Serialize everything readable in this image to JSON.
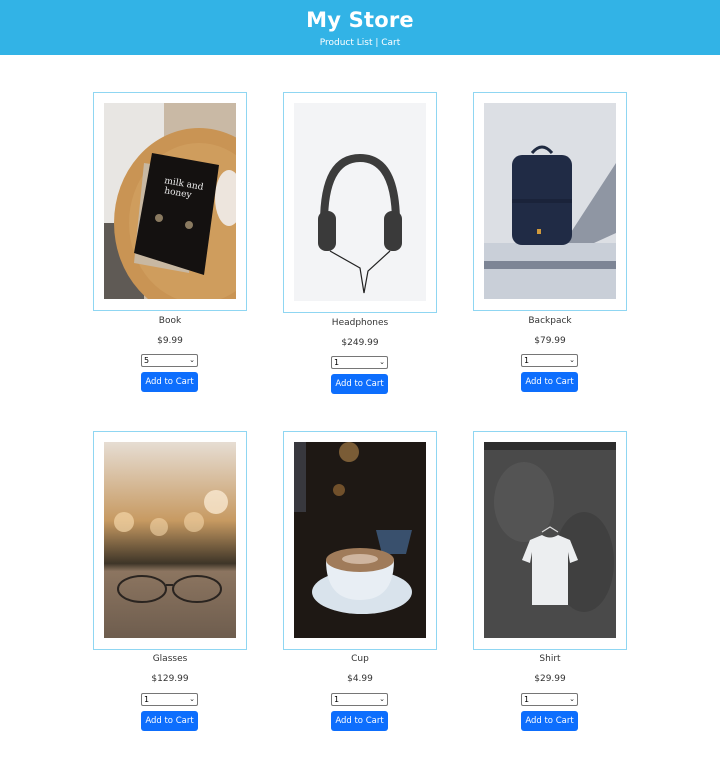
{
  "header": {
    "title": "My Store",
    "nav": {
      "product_list": "Product List",
      "separator": " | ",
      "cart": "Cart"
    },
    "background": "#32b3e6"
  },
  "products": [
    {
      "name": "Book",
      "price": "$9.99",
      "quantity": "5",
      "button": "Add to Cart",
      "image": "book-photo"
    },
    {
      "name": "Headphones",
      "price": "$249.99",
      "quantity": "1",
      "button": "Add to Cart",
      "image": "headphones-photo"
    },
    {
      "name": "Backpack",
      "price": "$79.99",
      "quantity": "1",
      "button": "Add to Cart",
      "image": "backpack-photo"
    },
    {
      "name": "Glasses",
      "price": "$129.99",
      "quantity": "1",
      "button": "Add to Cart",
      "image": "glasses-photo"
    },
    {
      "name": "Cup",
      "price": "$4.99",
      "quantity": "1",
      "button": "Add to Cart",
      "image": "cup-photo"
    },
    {
      "name": "Shirt",
      "price": "$29.99",
      "quantity": "1",
      "button": "Add to Cart",
      "image": "shirt-photo"
    }
  ],
  "colors": {
    "button": "#0d6efd",
    "card_border": "#8fd6f2"
  }
}
